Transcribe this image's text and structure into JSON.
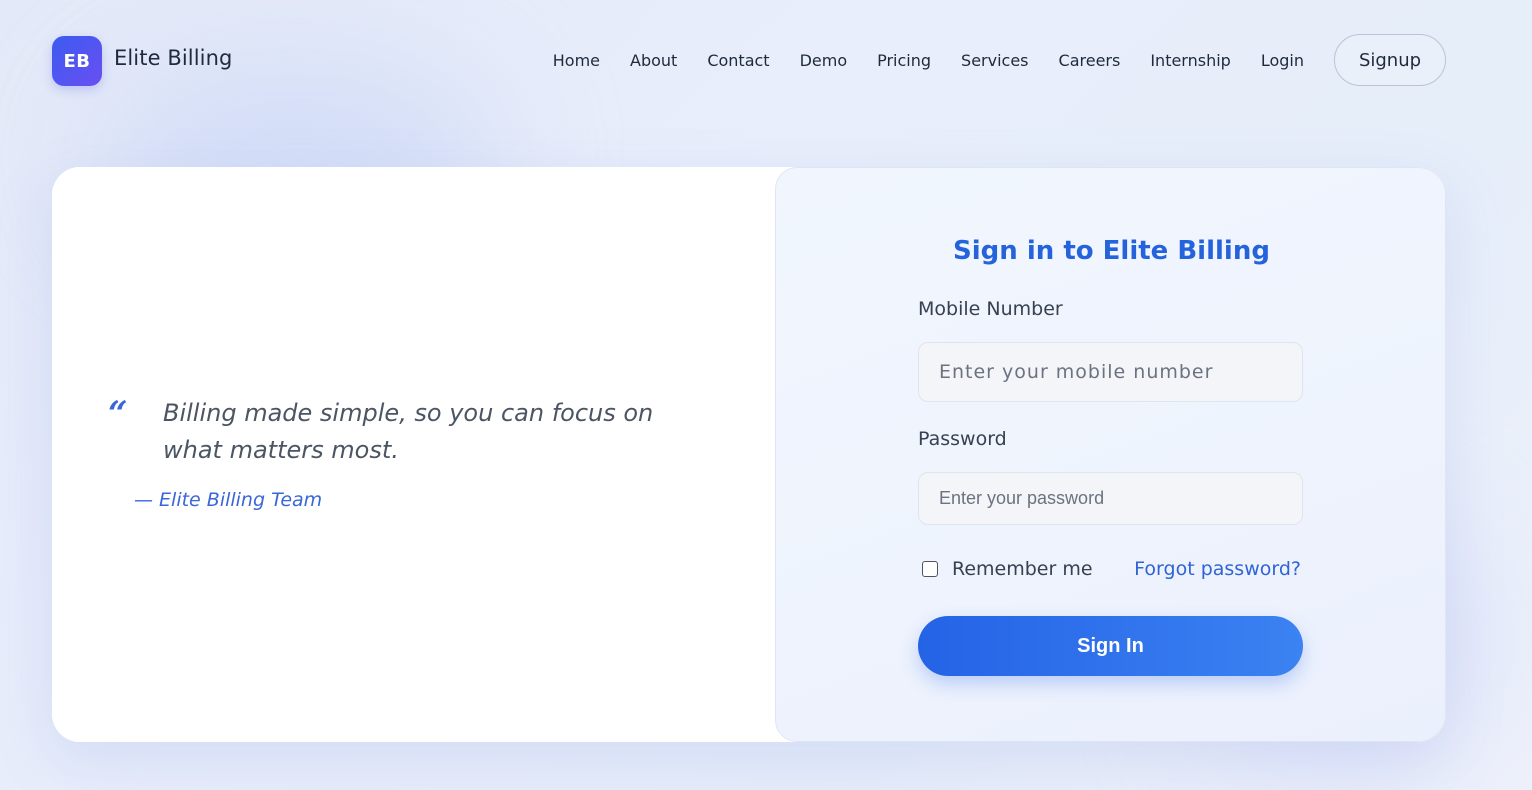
{
  "header": {
    "logo_badge": "EB",
    "brand_name": "Elite Billing",
    "nav": [
      {
        "label": "Home"
      },
      {
        "label": "About"
      },
      {
        "label": "Contact"
      },
      {
        "label": "Demo"
      },
      {
        "label": "Pricing"
      },
      {
        "label": "Services"
      },
      {
        "label": "Careers"
      },
      {
        "label": "Internship"
      },
      {
        "label": "Login"
      }
    ],
    "signup_label": "Signup"
  },
  "quote": {
    "mark": "“",
    "text": "Billing made simple, so you can focus on what matters most.",
    "author": "— Elite Billing Team"
  },
  "form": {
    "title": "Sign in to Elite Billing",
    "mobile_label": "Mobile Number",
    "mobile_placeholder": "Enter your mobile number",
    "password_label": "Password",
    "password_placeholder": "Enter your password",
    "remember_label": "Remember me",
    "remember_checked": false,
    "forgot_label": "Forgot password?",
    "submit_label": "Sign In"
  },
  "colors": {
    "accent": "#2563dc",
    "logo_gradient_start": "#3b5bf0",
    "logo_gradient_end": "#6a4ff2"
  }
}
